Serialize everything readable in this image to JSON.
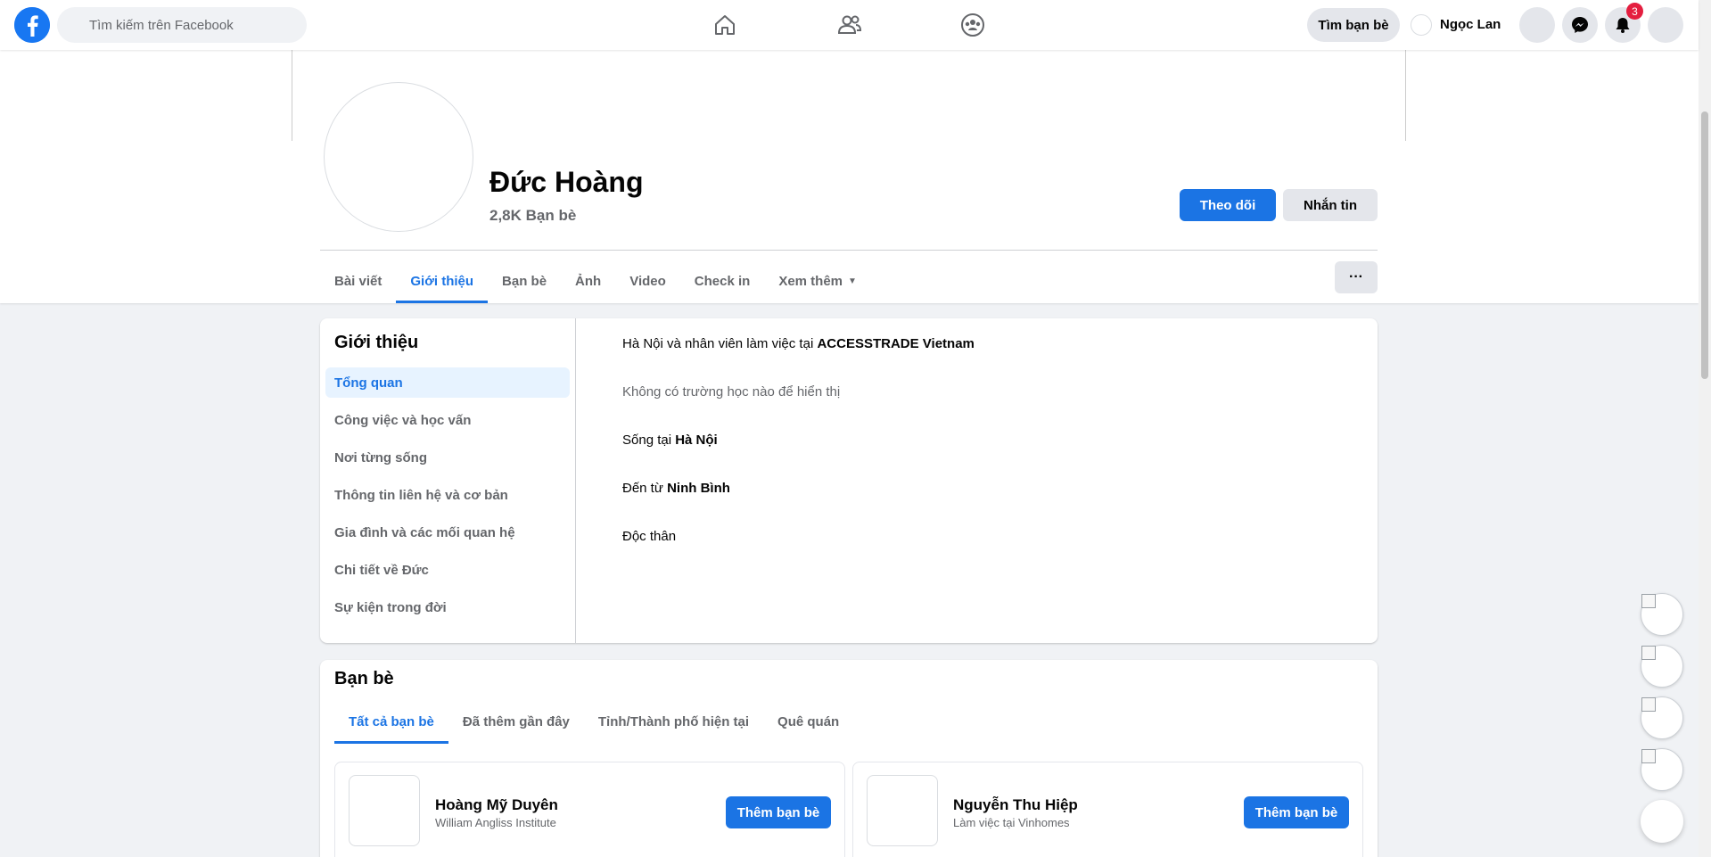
{
  "topbar": {
    "search_placeholder": "Tìm kiếm trên Facebook",
    "find_friends": "Tìm bạn bè",
    "user_name": "Ngọc Lan",
    "notification_count": "3"
  },
  "profile": {
    "name": "Đức Hoàng",
    "friend_count": "2,8K Bạn bè",
    "follow_label": "Theo dõi",
    "message_label": "Nhắn tin",
    "more_label": "···"
  },
  "tabs": [
    {
      "label": "Bài viết"
    },
    {
      "label": "Giới thiệu"
    },
    {
      "label": "Bạn bè"
    },
    {
      "label": "Ảnh"
    },
    {
      "label": "Video"
    },
    {
      "label": "Check in"
    },
    {
      "label": "Xem thêm"
    }
  ],
  "about": {
    "title": "Giới thiệu",
    "menu": [
      {
        "label": "Tổng quan"
      },
      {
        "label": "Công việc và học vấn"
      },
      {
        "label": "Nơi từng sống"
      },
      {
        "label": "Thông tin liên hệ và cơ bản"
      },
      {
        "label": "Gia đình và các mối quan hệ"
      },
      {
        "label": "Chi tiết về Đức"
      },
      {
        "label": "Sự kiện trong đời"
      }
    ],
    "work_prefix": "Hà Nội và nhân viên làm việc tại",
    "work_company": "ACCESSTRADE Vietnam",
    "school": "Không có trường học nào để hiển thị",
    "lives_prefix": "Sống tại",
    "lives_city": "Hà Nội",
    "from_prefix": "Đến từ",
    "from_city": "Ninh Bình",
    "relationship": "Độc thân"
  },
  "friends": {
    "title": "Bạn bè",
    "tabs": [
      {
        "label": "Tất cả bạn bè"
      },
      {
        "label": "Đã thêm gần đây"
      },
      {
        "label": "Tỉnh/Thành phố hiện tại"
      },
      {
        "label": "Quê quán"
      }
    ],
    "items": [
      {
        "name": "Hoàng Mỹ Duyên",
        "sub": "William Angliss Institute",
        "add_label": "Thêm bạn bè"
      },
      {
        "name": "Nguyễn Thu Hiệp",
        "sub": "Làm việc tại Vinhomes",
        "add_label": "Thêm bạn bè"
      }
    ]
  },
  "colors": {
    "brand": "#1877f2",
    "accent": "#1b74e4",
    "badge": "#e41e3f"
  }
}
